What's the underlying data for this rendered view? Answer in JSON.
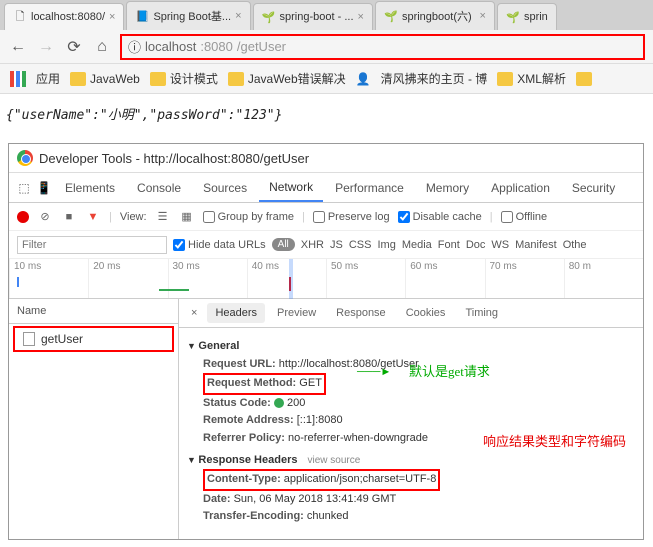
{
  "browser": {
    "tabs": [
      {
        "title": "localhost:8080/",
        "icon": "🗋"
      },
      {
        "title": "Spring Boot基...",
        "icon": "📘"
      },
      {
        "title": "spring-boot - ...",
        "icon": "🌱"
      },
      {
        "title": "springboot(六)",
        "icon": "🌱"
      },
      {
        "title": "sprin",
        "icon": "🌱"
      }
    ],
    "url": {
      "info_icon": "ⓘ",
      "host": "localhost",
      "port": ":8080",
      "path": "/getUser"
    },
    "bookmarks": {
      "apps": "应用",
      "items": [
        "JavaWeb",
        "设计模式",
        "JavaWeb错误解决",
        "清风拂来的主页 - 博",
        "XML解析"
      ]
    }
  },
  "page_response": "{\"userName\":\"小明\",\"passWord\":\"123\"}",
  "devtools": {
    "title": "Developer Tools - http://localhost:8080/getUser",
    "panels": [
      "Elements",
      "Console",
      "Sources",
      "Network",
      "Performance",
      "Memory",
      "Application",
      "Security"
    ],
    "active_panel": "Network",
    "toolbar": {
      "view_label": "View:",
      "group_by_frame": "Group by frame",
      "preserve_log": "Preserve log",
      "disable_cache": "Disable cache",
      "offline": "Offline"
    },
    "filter": {
      "placeholder": "Filter",
      "hide_data_urls": "Hide data URLs",
      "all": "All",
      "types": [
        "XHR",
        "JS",
        "CSS",
        "Img",
        "Media",
        "Font",
        "Doc",
        "WS",
        "Manifest",
        "Othe"
      ]
    },
    "timeline": [
      "10 ms",
      "20 ms",
      "30 ms",
      "40 ms",
      "50 ms",
      "60 ms",
      "70 ms",
      "80 m"
    ],
    "name_header": "Name",
    "request_name": "getUser",
    "detail_tabs": [
      "Headers",
      "Preview",
      "Response",
      "Cookies",
      "Timing"
    ],
    "headers": {
      "general_label": "General",
      "request_url_label": "Request URL:",
      "request_url": "http://localhost:8080/getUser",
      "request_method_label": "Request Method:",
      "request_method": "GET",
      "status_code_label": "Status Code:",
      "status_code": "200",
      "remote_address_label": "Remote Address:",
      "remote_address": "[::1]:8080",
      "referrer_policy_label": "Referrer Policy:",
      "referrer_policy": "no-referrer-when-downgrade",
      "response_headers_label": "Response Headers",
      "view_source": "view source",
      "content_type_label": "Content-Type:",
      "content_type": "application/json;charset=UTF-8",
      "date_label": "Date:",
      "date": "Sun, 06 May 2018 13:41:49 GMT",
      "transfer_encoding_label": "Transfer-Encoding:",
      "transfer_encoding": "chunked"
    },
    "annotations": {
      "request_note": "默认是get请求",
      "response_note": "响应结果类型和字符编码"
    }
  }
}
